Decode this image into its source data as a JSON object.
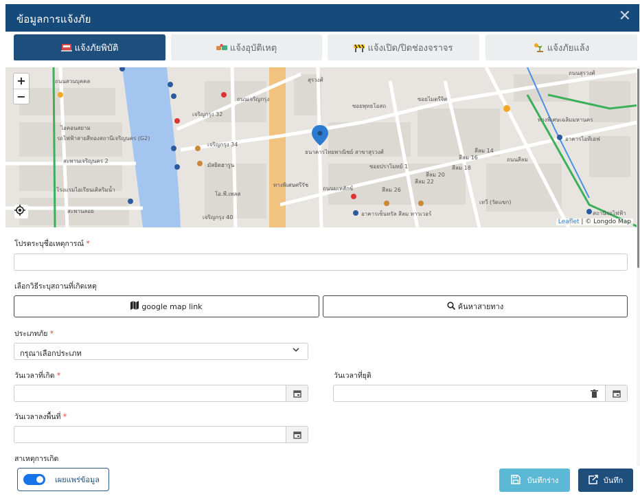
{
  "dialog": {
    "title": "ข้อมูลการแจ้งภัย",
    "close_glyph": "✕"
  },
  "tabs": [
    {
      "label": "แจ้งภัยพิบัติ",
      "icon": "disaster-icon",
      "active": true
    },
    {
      "label": "แจ้งอุบัติเหตุ",
      "icon": "accident-icon",
      "active": false
    },
    {
      "label": "แจ้งเปิด/ปิดช่องจราจร",
      "icon": "traffic-barrier-icon",
      "active": false
    },
    {
      "label": "แจ้งภัยแล้ง",
      "icon": "drought-icon",
      "active": false
    }
  ],
  "map": {
    "zoom_in": "+",
    "zoom_out": "−",
    "attribution_leaflet": "Leaflet",
    "attribution_rest": " | © Longdo Map",
    "labels": {
      "l1": "ถนนสวนบุคคล",
      "l2": "ไอคอนสยาม",
      "l3": "รถไฟฟ้าสายสีทองสถานีเจริญนคร (G2)",
      "l4": "สะพานเจริญนคร 2",
      "l5": "โรงแรมไอเรียนเติลริมน้ำ",
      "l6": "สะพานลอย",
      "l7": "เจริญกรุง 32",
      "l8": "เจริญกรุง 34",
      "l9": "มัสยิดฮารูน",
      "l10": "โอ.พี.เพลส",
      "l11": "เจริญกรุง 40",
      "l12": "ซอยพุทธโอสถ",
      "l13": "ซอยไมตรีจิต",
      "l14": "ธนาคารไทยพาณิชย์ สาขาสุรวงศ์",
      "l15": "ซอยปราโมทย์ 1",
      "l16": "สีลม 20",
      "l17": "สีลม 22",
      "l18": "สีลม 18",
      "l19": "สีลม 16",
      "l20": "สีลม 14",
      "l21": "สีลม 26",
      "l22": "อาคารเซ็นทรัล สีลม ทาวเวอร์",
      "l23": "ถนนสีลม",
      "l24": "ถนนมเหสักข์",
      "l25": "ทางพิเศษศรีรัช",
      "l26": "ถนนเจริญกรุง",
      "l27": "ถนนสุรวงศ์",
      "l28": "ทางพิเศษเฉลิมมหานคร",
      "l29": "อาคารไอทีเอฟ",
      "l30": "สถานีรถไฟฟ้า",
      "l31": "เทวี (วัดแขก)",
      "l32": "สุรวงศ์"
    }
  },
  "form": {
    "incident_name_label": "โปรดระบุชื่อเหตุการณ์",
    "req": "*",
    "location_method_label": "เลือกวิธีระบุสถานที่เกิดเหตุ",
    "google_map_label": "google map link",
    "search_route_label": "ค้นหาสายทาง",
    "hazard_type_label": "ประเภทภัย",
    "hazard_type_selected": "กรุณาเลือกประเภท",
    "start_time_label": "วันเวลาที่เกิด",
    "end_time_label": "วันเวลาที่ยุติ",
    "onsite_time_label": "วันเวลาลงพื้นที่",
    "cause_label": "สาเหตุการเกิด"
  },
  "footer": {
    "publish_label": "เผยแพร่ข้อมูล",
    "publish_on": true,
    "draft_label": "บันทึกร่าง",
    "save_label": "บันทึก"
  },
  "colors": {
    "header_bg": "#164a7a",
    "primary": "#1e4f7c",
    "draft_btn": "#5cb9d6",
    "toggle_on": "#1773e8",
    "required": "#d43"
  }
}
